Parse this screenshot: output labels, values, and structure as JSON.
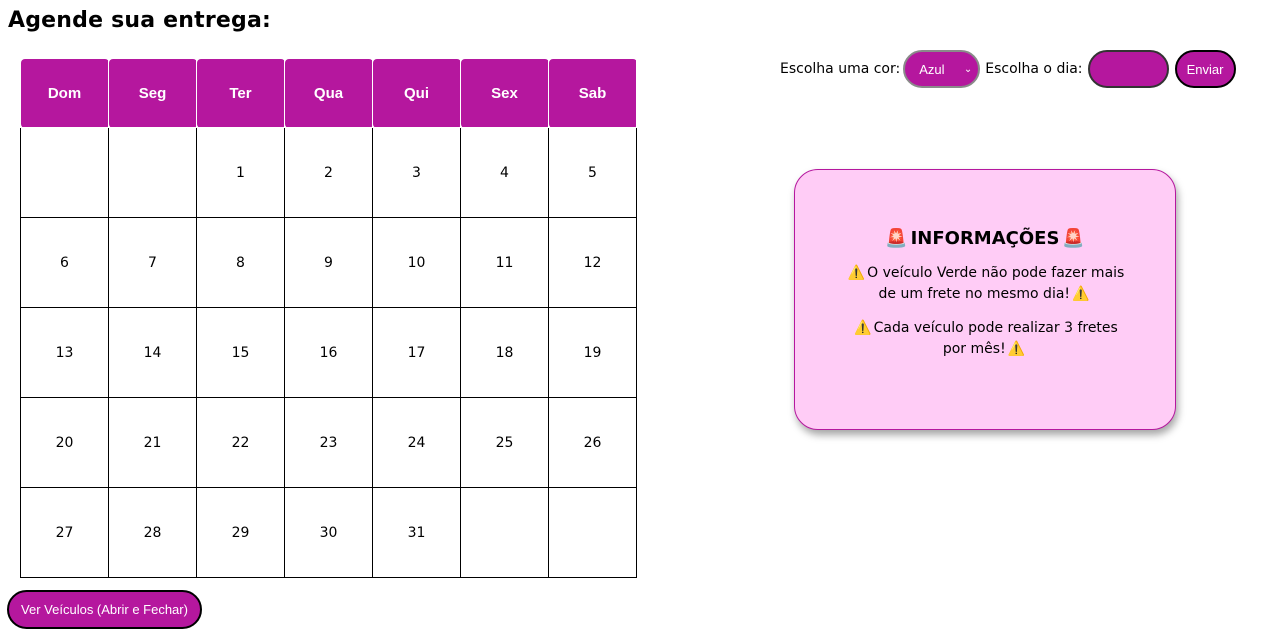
{
  "page": {
    "title": "Agende sua entrega:"
  },
  "calendar": {
    "weekdays": [
      "Dom",
      "Seg",
      "Ter",
      "Qua",
      "Qui",
      "Sex",
      "Sab"
    ],
    "weeks": [
      [
        "",
        "",
        "1",
        "2",
        "3",
        "4",
        "5"
      ],
      [
        "6",
        "7",
        "8",
        "9",
        "10",
        "11",
        "12"
      ],
      [
        "13",
        "14",
        "15",
        "16",
        "17",
        "18",
        "19"
      ],
      [
        "20",
        "21",
        "22",
        "23",
        "24",
        "25",
        "26"
      ],
      [
        "27",
        "28",
        "29",
        "30",
        "31",
        "",
        ""
      ]
    ]
  },
  "form": {
    "color_label": "Escolha uma cor:",
    "color_selected": "Azul",
    "day_label": "Escolha o dia:",
    "day_value": "",
    "submit_label": "Enviar"
  },
  "info": {
    "title": "INFORMAÇÕES",
    "icon_title": "🚨",
    "icon_warning": "⚠️",
    "line1": "O veículo Verde não pode fazer mais de um frete no mesmo dia!",
    "line2": "Cada veículo pode realizar 3 fretes por mês!"
  },
  "actions": {
    "vehicles_label": "Ver Veículos (Abrir e Fechar)"
  },
  "colors": {
    "accent": "#b5179e",
    "info_bg": "#ffccf6"
  }
}
